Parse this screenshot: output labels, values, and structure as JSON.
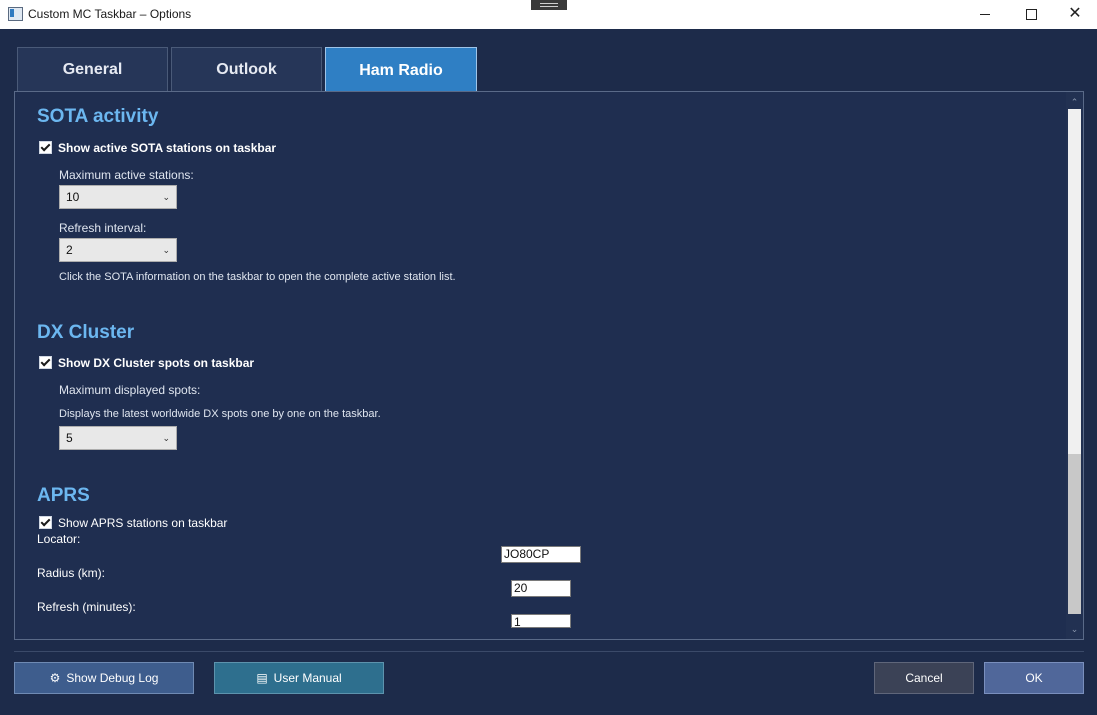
{
  "window": {
    "title": "Custom MC Taskbar – Options",
    "minimize": "minimize",
    "maximize": "maximize",
    "close": "✕"
  },
  "tabs": [
    {
      "label": "General"
    },
    {
      "label": "Outlook"
    },
    {
      "label": "Ham Radio",
      "selected": true
    }
  ],
  "sota": {
    "title": "SOTA activity",
    "show_label": "Show active SOTA stations on taskbar",
    "show_checked": true,
    "max_label": "Maximum active stations:",
    "max_value": "10",
    "refresh_label": "Refresh interval:",
    "refresh_value": "2",
    "hint": "Click the SOTA information on the taskbar to open the complete active station list."
  },
  "dx": {
    "title": "DX Cluster",
    "show_label": "Show DX Cluster spots on taskbar",
    "show_checked": true,
    "max_label": "Maximum displayed spots:",
    "hint": "Displays the latest worldwide DX spots one by one on the taskbar.",
    "max_value": "5"
  },
  "aprs": {
    "title": "APRS",
    "show_label": "Show APRS stations on taskbar",
    "show_checked": true,
    "locator_label": "Locator:",
    "locator_value": "JO80CP",
    "radius_label": "Radius (km):",
    "radius_value": "20",
    "refresh_label": "Refresh (minutes):",
    "refresh_value": "1"
  },
  "footer": {
    "debug_label": "Show Debug Log",
    "manual_label": "User Manual",
    "cancel_label": "Cancel",
    "ok_label": "OK"
  },
  "icons": {
    "debug": "gear-icon",
    "manual": "document-icon",
    "combo": "chevron-down-icon",
    "scroll_up": "chevron-up-icon",
    "scroll_down": "chevron-down-icon"
  },
  "colors": {
    "background": "#1d2b4a",
    "accent": "#2f7fc4",
    "section_title": "#6cb7f0"
  }
}
